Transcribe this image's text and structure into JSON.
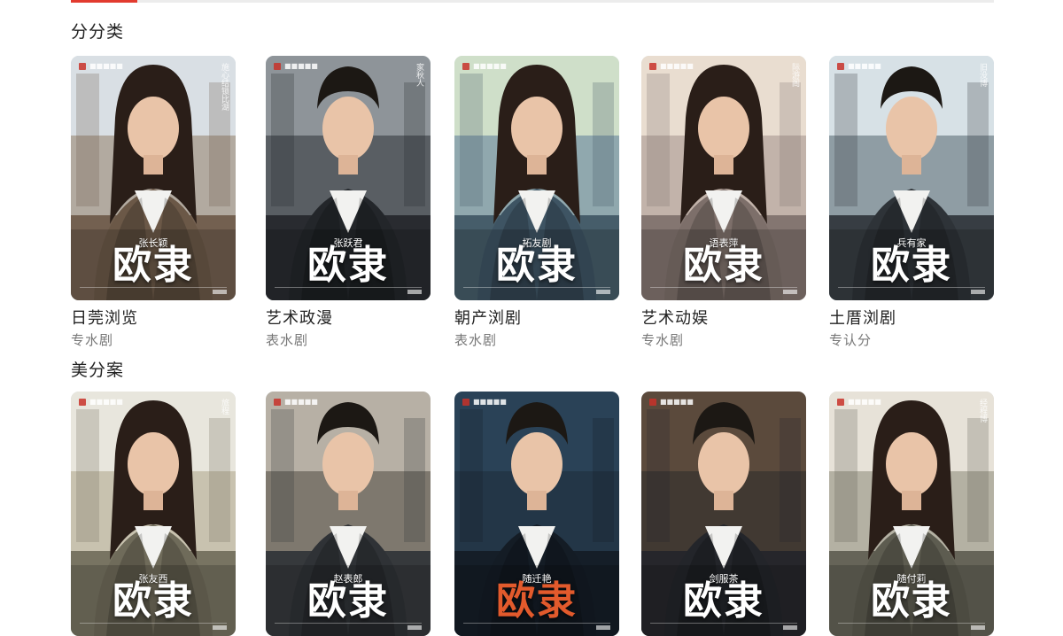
{
  "tabs_underline": {
    "accent_color": "#e23a2e"
  },
  "sections": [
    {
      "title": "分分类",
      "cards": [
        {
          "title": "日莞浏览",
          "subtitle": "专水剧",
          "poster_name": "张长颖",
          "poster_title": "欧隶",
          "poster_vertical": "施心结锁比湖",
          "bg": [
            "#d9dfe4",
            "#a79c8e",
            "#6b5847"
          ],
          "person": "female"
        },
        {
          "title": "艺术政漫",
          "subtitle": "表水剧",
          "poster_name": "张跃君",
          "poster_title": "欧隶",
          "poster_vertical": "家秋人",
          "bg": [
            "#8e9499",
            "#4c5055",
            "#23262a"
          ],
          "person": "male"
        },
        {
          "title": "朝产浏剧",
          "subtitle": "表水剧",
          "poster_name": "拓友剧",
          "poster_title": "欧隶",
          "poster_vertical": "",
          "bg": [
            "#cfdfc9",
            "#7f9aa8",
            "#3e5463"
          ],
          "person": "female"
        },
        {
          "title": "艺术动娱",
          "subtitle": "专水剧",
          "poster_name": "语表萍",
          "poster_title": "欧隶",
          "poster_vertical": "际游阁",
          "bg": [
            "#e9ddd0",
            "#b8a9a0",
            "#7d6f6a"
          ],
          "person": "female"
        },
        {
          "title": "土厝浏剧",
          "subtitle": "专认分",
          "poster_name": "兵有家",
          "poster_title": "欧隶",
          "poster_vertical": "旧没博",
          "bg": [
            "#d7e1e6",
            "#7d8c94",
            "#2e3338"
          ],
          "person": "male"
        }
      ]
    },
    {
      "title": "美分案",
      "cards": [
        {
          "title": "",
          "subtitle": "",
          "poster_name": "张友西",
          "poster_title": "欧隶",
          "poster_vertical": "旅程",
          "bg": [
            "#e8e6dd",
            "#bfb9a4",
            "#6f6b5a"
          ],
          "person": "female"
        },
        {
          "title": "",
          "subtitle": "",
          "poster_name": "赵表郎",
          "poster_title": "欧隶",
          "poster_vertical": "",
          "bg": [
            "#b7b0a5",
            "#6f6a60",
            "#2f3236"
          ],
          "person": "male"
        },
        {
          "title": "",
          "subtitle": "",
          "poster_name": "随迁艳",
          "poster_title": "欧隶",
          "poster_vertical": "",
          "bg": [
            "#2a4257",
            "#223344",
            "#141c25"
          ],
          "person": "male",
          "accent_title": "#e25a2c"
        },
        {
          "title": "",
          "subtitle": "",
          "poster_name": "剑服茶",
          "poster_title": "欧隶",
          "poster_vertical": "",
          "bg": [
            "#5b4a3c",
            "#3b3430",
            "#23252a"
          ],
          "person": "male"
        },
        {
          "title": "",
          "subtitle": "",
          "poster_name": "随付莉",
          "poster_title": "欧隶",
          "poster_vertical": "经程博",
          "bg": [
            "#e7e2d8",
            "#a8a596",
            "#5d5c50"
          ],
          "person": "female"
        }
      ]
    }
  ],
  "poster_badge_text": "■■■■■"
}
